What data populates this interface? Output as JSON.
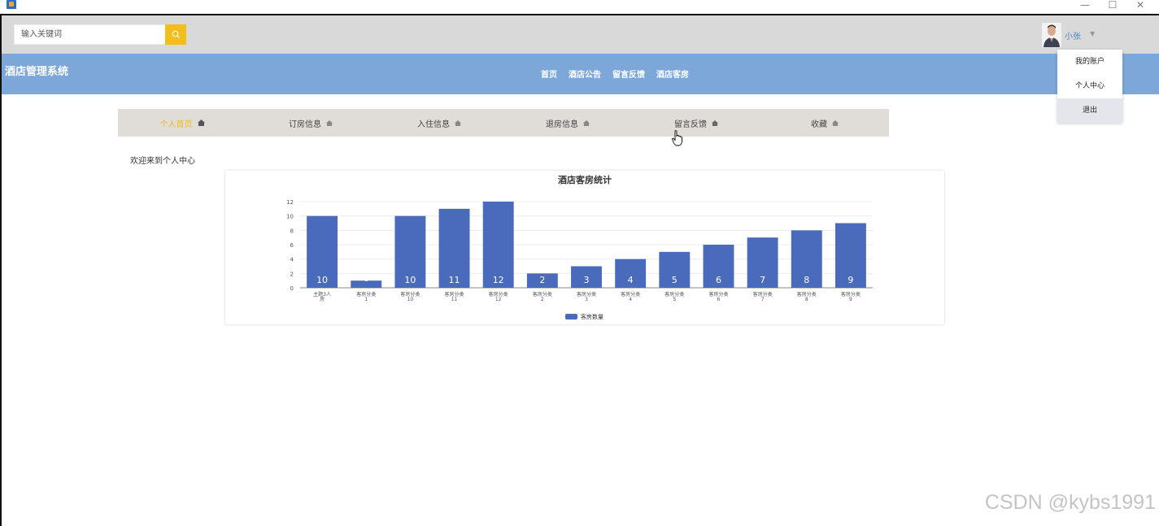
{
  "window": {
    "controls": [
      "—",
      "☐",
      "✕"
    ]
  },
  "search": {
    "placeholder": "输入关键词"
  },
  "user": {
    "name": "小张",
    "menu": [
      "我的账户",
      "个人中心",
      "退出"
    ]
  },
  "brand": "酒店管理系统",
  "nav": [
    "首页",
    "酒店公告",
    "留言反馈",
    "酒店客房"
  ],
  "subtabs": [
    {
      "label": "个人首页",
      "active": true
    },
    {
      "label": "订房信息",
      "active": false
    },
    {
      "label": "入住信息",
      "active": false
    },
    {
      "label": "退房信息",
      "active": false
    },
    {
      "label": "留言反馈",
      "active": false
    },
    {
      "label": "收藏",
      "active": false
    }
  ],
  "welcome": "欢迎来到个人中心",
  "colors": {
    "accent": "#f3bd1a",
    "nav": "#7da7d9",
    "bar": "#4a6abc"
  },
  "chart_data": {
    "type": "bar",
    "title": "酒店客房统计",
    "categories": [
      [
        "主题3人",
        "房"
      ],
      [
        "客房分类",
        "1"
      ],
      [
        "客房分类",
        "10"
      ],
      [
        "客房分类",
        "11"
      ],
      [
        "客房分类",
        "12"
      ],
      [
        "客房分类",
        "2"
      ],
      [
        "客房分类",
        "3"
      ],
      [
        "客房分类",
        "4"
      ],
      [
        "客房分类",
        "5"
      ],
      [
        "客房分类",
        "6"
      ],
      [
        "客房分类",
        "7"
      ],
      [
        "客房分类",
        "8"
      ],
      [
        "客房分类",
        "9"
      ]
    ],
    "series": [
      {
        "name": "客房数量",
        "values": [
          10,
          1,
          10,
          11,
          12,
          2,
          3,
          4,
          5,
          6,
          7,
          8,
          9
        ]
      }
    ],
    "ylim": [
      0,
      12
    ],
    "yticks": [
      0,
      2,
      4,
      6,
      8,
      10,
      12
    ],
    "grid": true,
    "legend": "bottom"
  },
  "watermark": "CSDN @kybs1991"
}
